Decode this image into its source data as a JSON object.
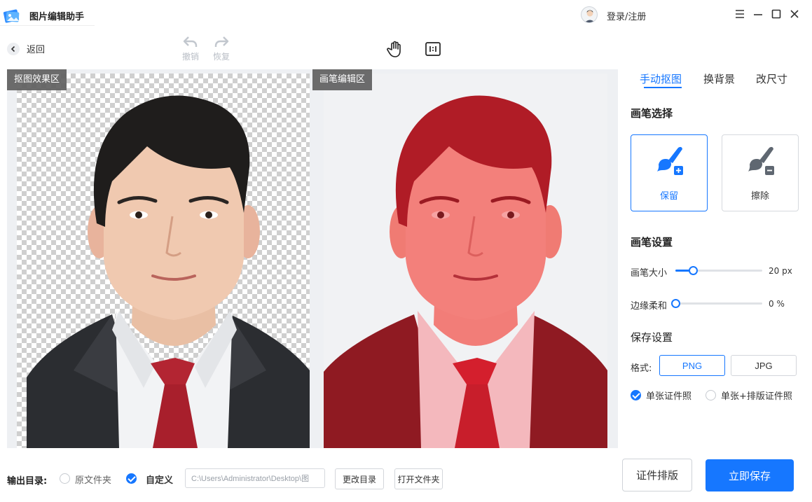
{
  "app": {
    "title": "图片编辑助手",
    "login": "登录/注册"
  },
  "toolbar": {
    "back": "返回",
    "undo": "撤销",
    "redo": "恢复"
  },
  "canvas": {
    "result_tag": "抠图效果区",
    "brush_tag": "画笔编辑区"
  },
  "panel": {
    "tabs": [
      {
        "label": "手动抠图",
        "active": true
      },
      {
        "label": "换背景",
        "active": false
      },
      {
        "label": "改尺寸",
        "active": false
      }
    ],
    "brush_select_title": "画笔选择",
    "brush_keep": "保留",
    "brush_erase": "擦除",
    "brush_settings_title": "画笔设置",
    "brush_size": {
      "label": "画笔大小",
      "value": "20 px",
      "fraction": 0.2
    },
    "edge_soft": {
      "label": "边缘柔和",
      "value": "0 %",
      "fraction": 0.0
    },
    "save_settings_title": "保存设置",
    "format_label": "格式:",
    "formats": [
      {
        "label": "PNG",
        "active": true
      },
      {
        "label": "JPG",
        "active": false
      }
    ],
    "single_photo": "单张证件照",
    "single_plus_layout": "单张+排版证件照"
  },
  "bottom": {
    "output_label": "输出目录:",
    "original_folder": "原文件夹",
    "custom": "自定义",
    "path": "C:\\Users\\Administrator\\Desktop\\图",
    "change_dir": "更改目录",
    "open_folder": "打开文件夹",
    "layout_button": "证件排版",
    "save_button": "立即保存"
  },
  "colors": {
    "accent": "#1677ff",
    "mask": "#e0343a"
  },
  "icons": [
    "app-logo-icon",
    "user-avatar-icon",
    "menu-icon",
    "minimize-icon",
    "maximize-icon",
    "close-icon",
    "chevron-left-icon",
    "undo-icon",
    "redo-icon",
    "hand-icon",
    "actual-size-icon",
    "brush-plus-icon",
    "brush-minus-icon",
    "check-icon"
  ]
}
